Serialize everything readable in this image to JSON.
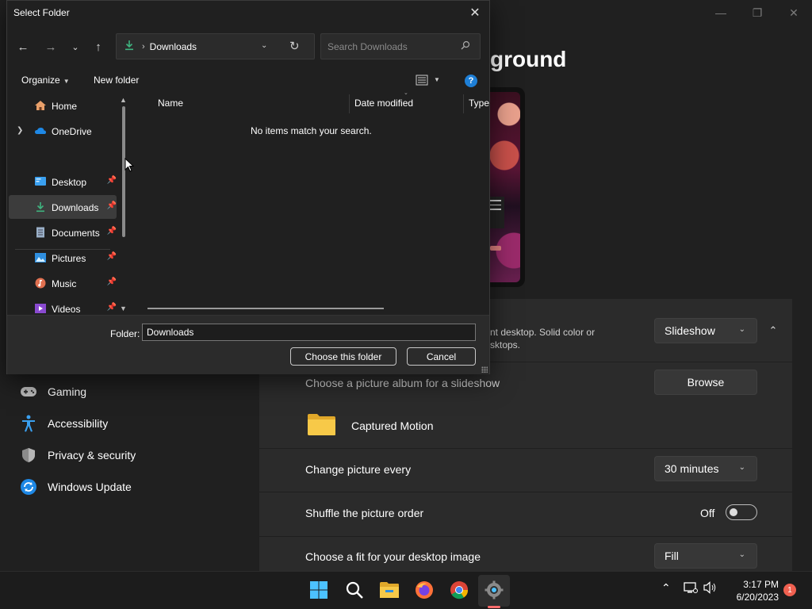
{
  "settings": {
    "title": "ground",
    "background_row": {
      "subtitle_line1": "nt desktop. Solid color or",
      "subtitle_line2": "sktops.",
      "type_value": "Slideshow"
    },
    "album_row": {
      "label": "Choose a picture album for a slideshow",
      "button": "Browse"
    },
    "album_folder": {
      "name": "Captured Motion"
    },
    "interval_row": {
      "label": "Change picture every",
      "value": "30 minutes"
    },
    "shuffle_row": {
      "label": "Shuffle the picture order",
      "state": "Off"
    },
    "fit_row": {
      "label": "Choose a fit for your desktop image",
      "value": "Fill"
    },
    "sidebar": [
      {
        "label": "Gaming",
        "icon": "gamepad-icon"
      },
      {
        "label": "Accessibility",
        "icon": "accessibility-icon"
      },
      {
        "label": "Privacy & security",
        "icon": "shield-icon"
      },
      {
        "label": "Windows Update",
        "icon": "update-icon"
      }
    ]
  },
  "dialog": {
    "title": "Select Folder",
    "address": {
      "location": "Downloads"
    },
    "search": {
      "placeholder": "Search Downloads"
    },
    "commands": {
      "organize": "Organize",
      "new_folder": "New folder"
    },
    "tree": [
      {
        "label": "Home",
        "icon": "home-icon",
        "pinned": false
      },
      {
        "label": "OneDrive",
        "icon": "cloud-icon",
        "pinned": false
      },
      {
        "label": "Desktop",
        "icon": "desktop-icon",
        "pinned": true
      },
      {
        "label": "Downloads",
        "icon": "download-icon",
        "pinned": true,
        "selected": true
      },
      {
        "label": "Documents",
        "icon": "document-icon",
        "pinned": true
      },
      {
        "label": "Pictures",
        "icon": "pictures-icon",
        "pinned": true
      },
      {
        "label": "Music",
        "icon": "music-icon",
        "pinned": true
      },
      {
        "label": "Videos",
        "icon": "videos-icon",
        "pinned": true
      }
    ],
    "columns": {
      "name": "Name",
      "date_modified": "Date modified",
      "type": "Type"
    },
    "empty_message": "No items match your search.",
    "folder_label": "Folder:",
    "folder_value": "Downloads",
    "choose_button": "Choose this folder",
    "cancel_button": "Cancel"
  },
  "taskbar": {
    "time": "3:17 PM",
    "date": "6/20/2023",
    "notification_count": "1",
    "active_app": "settings"
  },
  "colors": {
    "accent": "#1e7fd6",
    "download_green": "#3fb37f",
    "folder_yellow": "#f7c948"
  }
}
